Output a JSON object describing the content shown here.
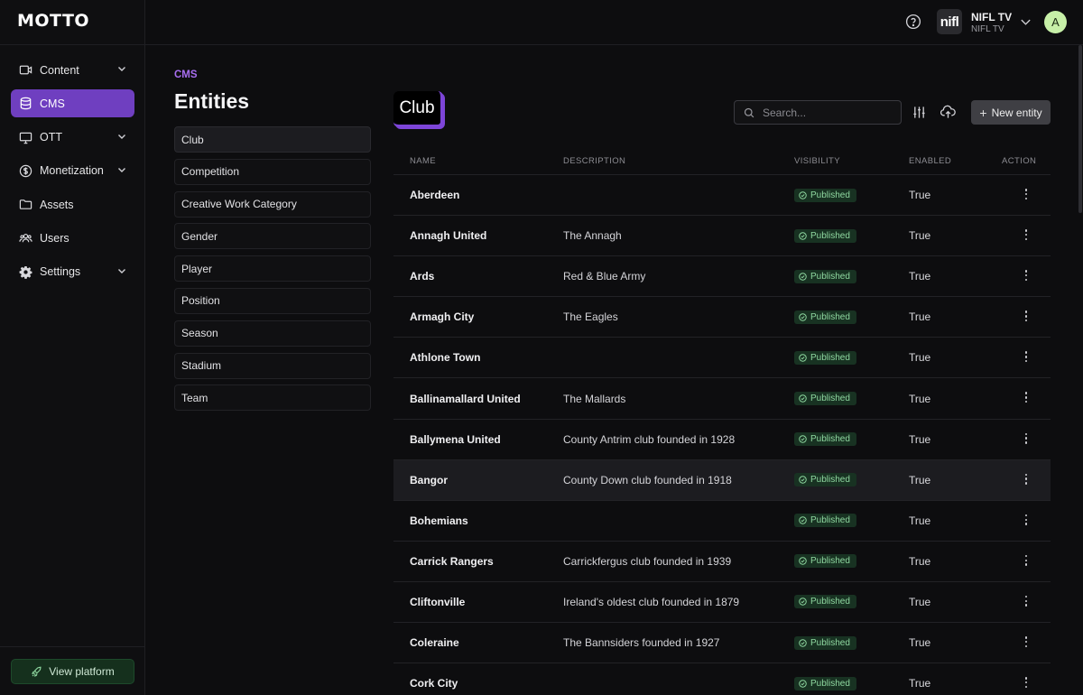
{
  "app": {
    "logo": "MOTTO"
  },
  "sidebar": {
    "items": [
      {
        "label": "Content",
        "icon": "video-icon",
        "expandable": true,
        "active": false
      },
      {
        "label": "CMS",
        "icon": "database-icon",
        "expandable": false,
        "active": true
      },
      {
        "label": "OTT",
        "icon": "monitor-icon",
        "expandable": true,
        "active": false
      },
      {
        "label": "Monetization",
        "icon": "dollar-icon",
        "expandable": true,
        "active": false
      },
      {
        "label": "Assets",
        "icon": "folder-icon",
        "expandable": false,
        "active": false
      },
      {
        "label": "Users",
        "icon": "users-icon",
        "expandable": false,
        "active": false
      },
      {
        "label": "Settings",
        "icon": "gear-icon",
        "expandable": true,
        "active": false
      }
    ],
    "view_platform": "View platform"
  },
  "header": {
    "org_logo": "nifl",
    "org_name": "NIFL TV",
    "org_sub": "NIFL TV",
    "avatar_initial": "A"
  },
  "page": {
    "breadcrumb": "CMS",
    "title": "Entities"
  },
  "entities": [
    {
      "label": "Club",
      "active": true
    },
    {
      "label": "Competition"
    },
    {
      "label": "Creative Work Category"
    },
    {
      "label": "Gender"
    },
    {
      "label": "Player"
    },
    {
      "label": "Position"
    },
    {
      "label": "Season"
    },
    {
      "label": "Stadium"
    },
    {
      "label": "Team"
    }
  ],
  "main": {
    "title": "Club",
    "search_placeholder": "Search...",
    "new_entity_label": "New entity",
    "columns": {
      "name": "NAME",
      "description": "DESCRIPTION",
      "visibility": "VISIBILITY",
      "enabled": "ENABLED",
      "action": "ACTION"
    },
    "rows": [
      {
        "name": "Aberdeen",
        "description": "",
        "visibility": "Published",
        "enabled": "True"
      },
      {
        "name": "Annagh United",
        "description": "The Annagh",
        "visibility": "Published",
        "enabled": "True"
      },
      {
        "name": "Ards",
        "description": "Red & Blue Army",
        "visibility": "Published",
        "enabled": "True"
      },
      {
        "name": "Armagh City",
        "description": "The Eagles",
        "visibility": "Published",
        "enabled": "True"
      },
      {
        "name": "Athlone Town",
        "description": "",
        "visibility": "Published",
        "enabled": "True"
      },
      {
        "name": "Ballinamallard United",
        "description": "The Mallards",
        "visibility": "Published",
        "enabled": "True"
      },
      {
        "name": "Ballymena United",
        "description": "County Antrim club founded in 1928",
        "visibility": "Published",
        "enabled": "True"
      },
      {
        "name": "Bangor",
        "description": "County Down club founded in 1918",
        "visibility": "Published",
        "enabled": "True",
        "highlighted": true
      },
      {
        "name": "Bohemians",
        "description": "",
        "visibility": "Published",
        "enabled": "True"
      },
      {
        "name": "Carrick Rangers",
        "description": "Carrickfergus club founded in 1939",
        "visibility": "Published",
        "enabled": "True"
      },
      {
        "name": "Cliftonville",
        "description": "Ireland's oldest club founded in 1879",
        "visibility": "Published",
        "enabled": "True"
      },
      {
        "name": "Coleraine",
        "description": "The Bannsiders founded in 1927",
        "visibility": "Published",
        "enabled": "True"
      },
      {
        "name": "Cork City",
        "description": "",
        "visibility": "Published",
        "enabled": "True"
      }
    ]
  },
  "colors": {
    "accent": "#6f3fc0",
    "published_bg": "#183222",
    "published_fg": "#8fd8a0"
  }
}
